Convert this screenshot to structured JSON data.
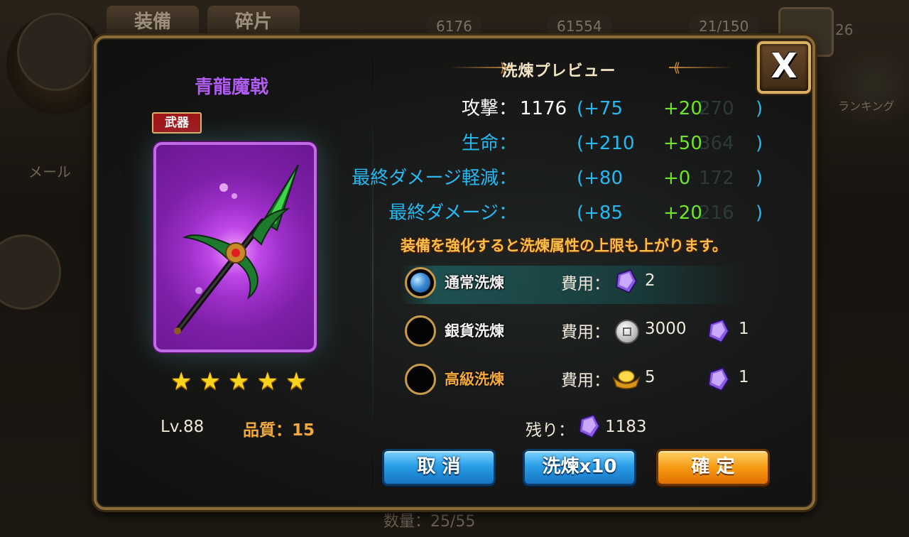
{
  "background": {
    "tabs": [
      "装備",
      "碎片"
    ],
    "resources": [
      "6176",
      "61554",
      "21/150",
      "26"
    ],
    "side_labels": [
      "メール",
      "ランキング"
    ],
    "bottom_text": "数量：25/55"
  },
  "item": {
    "name": "青龍魔戟",
    "tag": "武器",
    "stars": 5,
    "level": "Lv.88",
    "quality": "品質：15"
  },
  "preview": {
    "title": "洗煉プレビュー",
    "stats": [
      {
        "label": "攻撃：",
        "base": "1176",
        "open": "(+75",
        "plus": "+20",
        "ghost": "270",
        "close": ")"
      },
      {
        "label": "生命：",
        "base": "",
        "open": "(+210",
        "plus": "+50",
        "ghost": "364",
        "close": ")"
      },
      {
        "label": "最終ダメージ軽減：",
        "base": "",
        "open": "(+80",
        "plus": "+0",
        "ghost": "172",
        "close": ")"
      },
      {
        "label": "最終ダメージ：",
        "base": "",
        "open": "(+85",
        "plus": "+20",
        "ghost": "216",
        "close": ")"
      }
    ],
    "notice": "装備を強化すると洗煉属性の上限も上がります。"
  },
  "options": [
    {
      "label": "通常洗煉",
      "cost_label": "費用：",
      "cost1": "2",
      "cost2": "",
      "selected": true
    },
    {
      "label": "銀貨洗煉",
      "cost_label": "費用：",
      "cost1": "3000",
      "cost2": "1",
      "selected": false
    },
    {
      "label": "高級洗煉",
      "cost_label": "費用：",
      "cost1": "5",
      "cost2": "1",
      "selected": false
    }
  ],
  "remaining": {
    "label": "残り：",
    "value": "1183"
  },
  "buttons": {
    "cancel": "取 消",
    "refine10": "洗煉x10",
    "confirm": "確 定"
  },
  "close_label": "X",
  "colors": {
    "stat_blue": "#28b8f0",
    "stat_green": "#6ee626",
    "item_purple": "#b15cf0",
    "gold": "#f2a93a"
  }
}
